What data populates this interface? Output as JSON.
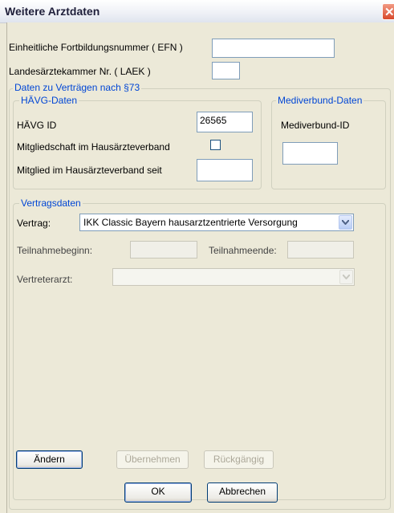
{
  "window": {
    "title": "Weitere Arztdaten"
  },
  "efn": {
    "label": "Einheitliche Fortbildungsnummer ( EFN )",
    "value": ""
  },
  "laek": {
    "label": "Landesärztekammer Nr. ( LAEK )",
    "value": ""
  },
  "vertraege_group": {
    "legend": "Daten zu Verträgen nach §73"
  },
  "haevg": {
    "legend": "HÄVG-Daten",
    "id_label": "HÄVG ID",
    "id_value": "26565",
    "mitgliedschaft_label": "Mitgliedschaft im Hausärzteverband",
    "mitgliedschaft_checked": false,
    "mitglied_seit_label": "Mitglied im Hausärzteverband seit",
    "mitglied_seit_value": ""
  },
  "mediverbund": {
    "legend": "Mediverbund-Daten",
    "id_label": "Mediverbund-ID",
    "id_value": ""
  },
  "vertragsdaten": {
    "legend": "Vertragsdaten",
    "vertrag_label": "Vertrag:",
    "vertrag_value": "IKK Classic Bayern hausarztzentrierte Versorgung",
    "teilnahmebeginn_label": "Teilnahmebeginn:",
    "teilnahmebeginn_value": "",
    "teilnahmeende_label": "Teilnahmeende:",
    "teilnahmeende_value": "",
    "vertreterarzt_label": "Vertreterarzt:",
    "vertreterarzt_value": ""
  },
  "actions": {
    "aendern": "Ändern",
    "uebernehmen": "Übernehmen",
    "rueckgaengig": "Rückgängig"
  },
  "dialog_buttons": {
    "ok": "OK",
    "abbrechen": "Abbrechen"
  }
}
